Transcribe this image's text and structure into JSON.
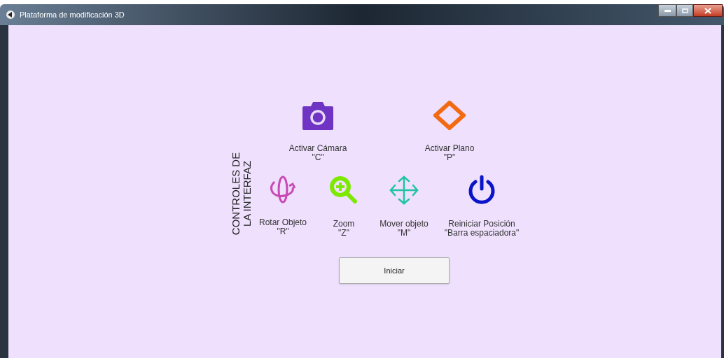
{
  "window": {
    "title": "Plataforma de modificación 3D"
  },
  "heading": {
    "lines": [
      "CONTROLES DE",
      "LA INTERFAZ"
    ]
  },
  "rows": [
    [
      {
        "kind": "camera",
        "label": "Activar Cámara",
        "key": "\"C\""
      },
      {
        "kind": "diamond",
        "label": "Activar Plano",
        "key": "\"P\""
      }
    ],
    [
      {
        "kind": "rotate",
        "label": "Rotar Objeto",
        "key": "\"R\""
      },
      {
        "kind": "zoom",
        "label": "Zoom",
        "key": "\"Z\""
      },
      {
        "kind": "move",
        "label": "Mover objeto",
        "key": "\"M\""
      },
      {
        "kind": "power",
        "label": "Reiniciar Posición",
        "key": "\"Barra espaciadora\""
      }
    ]
  ],
  "start_button": {
    "label": "Iniciar"
  }
}
